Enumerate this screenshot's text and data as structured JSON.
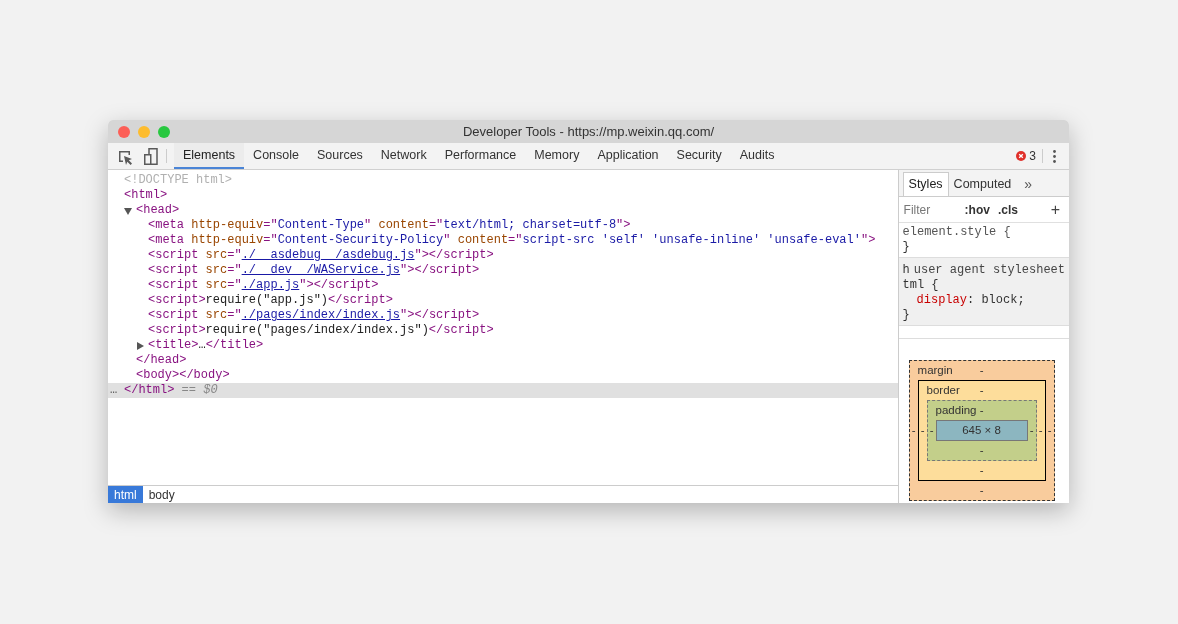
{
  "window": {
    "title": "Developer Tools - https://mp.weixin.qq.com/"
  },
  "tabs": [
    {
      "label": "Elements",
      "selected": true
    },
    {
      "label": "Console",
      "selected": false
    },
    {
      "label": "Sources",
      "selected": false
    },
    {
      "label": "Network",
      "selected": false
    },
    {
      "label": "Performance",
      "selected": false
    },
    {
      "label": "Memory",
      "selected": false
    },
    {
      "label": "Application",
      "selected": false
    },
    {
      "label": "Security",
      "selected": false
    },
    {
      "label": "Audits",
      "selected": false
    }
  ],
  "error_count": "3",
  "dom": [
    {
      "selected": false,
      "tokens": [
        {
          "kind": "doctype",
          "text": "<!DOCTYPE html>"
        }
      ]
    },
    {
      "selected": true,
      "tokens": [
        {
          "kind": "tag",
          "text": "<html>"
        }
      ],
      "close": [
        {
          "kind": "ellipsis",
          "text": "…"
        },
        {
          "kind": "tag",
          "text": "</html>"
        },
        {
          "kind": "marker",
          "text": " == $0"
        }
      ],
      "children": [
        {
          "selected": false,
          "expanded": true,
          "tokens": [
            {
              "kind": "tag",
              "text": "<head>"
            }
          ],
          "close": [
            {
              "kind": "tag",
              "text": "</head>"
            }
          ],
          "children": [
            {
              "selected": false,
              "tokens": [
                {
                  "kind": "tag",
                  "text": "<meta"
                },
                {
                  "kind": "attr",
                  "text": " http-equiv"
                },
                {
                  "kind": "tag",
                  "text": "=\""
                },
                {
                  "kind": "value",
                  "text": "Content-Type"
                },
                {
                  "kind": "tag",
                  "text": "\""
                },
                {
                  "kind": "attr",
                  "text": " content"
                },
                {
                  "kind": "tag",
                  "text": "=\""
                },
                {
                  "kind": "value",
                  "text": "text/html; charset=utf-8"
                },
                {
                  "kind": "tag",
                  "text": "\">"
                }
              ]
            },
            {
              "selected": false,
              "tokens": [
                {
                  "kind": "tag",
                  "text": "<meta"
                },
                {
                  "kind": "attr",
                  "text": " http-equiv"
                },
                {
                  "kind": "tag",
                  "text": "=\""
                },
                {
                  "kind": "value",
                  "text": "Content-Security-Policy"
                },
                {
                  "kind": "tag",
                  "text": "\""
                },
                {
                  "kind": "attr",
                  "text": " content"
                },
                {
                  "kind": "tag",
                  "text": "=\""
                },
                {
                  "kind": "value",
                  "text": "script-src 'self' 'unsafe-inline' 'unsafe-eval'"
                },
                {
                  "kind": "tag",
                  "text": "\">"
                }
              ]
            },
            {
              "selected": false,
              "tokens": [
                {
                  "kind": "tag",
                  "text": "<script"
                },
                {
                  "kind": "attr",
                  "text": " src"
                },
                {
                  "kind": "tag",
                  "text": "=\""
                },
                {
                  "kind": "link",
                  "text": "./__asdebug__/asdebug.js"
                },
                {
                  "kind": "tag",
                  "text": "\"></script>"
                }
              ]
            },
            {
              "selected": false,
              "tokens": [
                {
                  "kind": "tag",
                  "text": "<script"
                },
                {
                  "kind": "attr",
                  "text": " src"
                },
                {
                  "kind": "tag",
                  "text": "=\""
                },
                {
                  "kind": "link",
                  "text": "./__dev__/WAService.js"
                },
                {
                  "kind": "tag",
                  "text": "\"></script>"
                }
              ]
            },
            {
              "selected": false,
              "tokens": [
                {
                  "kind": "tag",
                  "text": "<script"
                },
                {
                  "kind": "attr",
                  "text": " src"
                },
                {
                  "kind": "tag",
                  "text": "=\""
                },
                {
                  "kind": "link",
                  "text": "./app.js"
                },
                {
                  "kind": "tag",
                  "text": "\"></script>"
                }
              ]
            },
            {
              "selected": false,
              "tokens": [
                {
                  "kind": "tag",
                  "text": "<script>"
                },
                {
                  "kind": "text",
                  "text": "require(\"app.js\")"
                },
                {
                  "kind": "tag",
                  "text": "</script>"
                }
              ]
            },
            {
              "selected": false,
              "tokens": [
                {
                  "kind": "tag",
                  "text": "<script"
                },
                {
                  "kind": "attr",
                  "text": " src"
                },
                {
                  "kind": "tag",
                  "text": "=\""
                },
                {
                  "kind": "link",
                  "text": "./pages/index/index.js"
                },
                {
                  "kind": "tag",
                  "text": "\"></script>"
                }
              ]
            },
            {
              "selected": false,
              "tokens": [
                {
                  "kind": "tag",
                  "text": "<script>"
                },
                {
                  "kind": "text",
                  "text": "require(\"pages/index/index.js\")"
                },
                {
                  "kind": "tag",
                  "text": "</script>"
                }
              ]
            },
            {
              "selected": false,
              "expanded": false,
              "tokens": [
                {
                  "kind": "tag",
                  "text": "<title>"
                },
                {
                  "kind": "text",
                  "text": "…"
                },
                {
                  "kind": "tag",
                  "text": "</title>"
                }
              ]
            }
          ]
        },
        {
          "selected": false,
          "tokens": [
            {
              "kind": "tag",
              "text": "<body></body>"
            }
          ]
        }
      ]
    }
  ],
  "breadcrumbs": [
    {
      "label": "html",
      "selected": true
    },
    {
      "label": "body",
      "selected": false
    }
  ],
  "styles_tabs": [
    {
      "label": "Styles",
      "selected": true
    },
    {
      "label": "Computed",
      "selected": false
    }
  ],
  "more_tabs": "»",
  "filter": {
    "placeholder": "Filter",
    "hov": ":hov",
    "cls": ".cls",
    "add": "+"
  },
  "rules": [
    {
      "kind": "inline",
      "selector": "element.style {",
      "end": "}"
    },
    {
      "kind": "agent",
      "selector_start": "h",
      "source": "user agent stylesheet",
      "selector_rest": "tml {",
      "declarations": [
        {
          "property": "display",
          "value": ": block;"
        }
      ],
      "end": "}"
    }
  ],
  "box_model": {
    "margin": {
      "label": "margin",
      "top": "-",
      "right": "-",
      "bottom": "-",
      "left": "-"
    },
    "border": {
      "label": "border",
      "top": "-",
      "right": "-",
      "bottom": "-",
      "left": "-"
    },
    "padding": {
      "label": "padding",
      "top": "-",
      "right": "-",
      "bottom": "-",
      "left": "-"
    },
    "content": "645 × 8"
  }
}
